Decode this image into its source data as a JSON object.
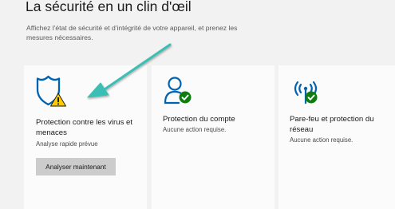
{
  "page": {
    "title": "La sécurité en un clin d'œil",
    "subtitle": "Affichez l'état de sécurité et d'intégrité de votre appareil, et prenez les mesures nécessaires."
  },
  "cards": [
    {
      "title": "Protection contre les virus et menaces",
      "status": "Analyse rapide prévue",
      "button_label": "Analyser maintenant",
      "icon": "shield-warning-icon"
    },
    {
      "title": "Protection du compte",
      "status": "Aucune action requise.",
      "icon": "person-check-icon"
    },
    {
      "title": "Pare-feu et protection du réseau",
      "status": "Aucune action requise.",
      "icon": "wireless-check-icon"
    }
  ],
  "colors": {
    "accent_blue": "#0063b1",
    "warning_yellow": "#ffcc00",
    "success_green": "#107c10",
    "annotation_arrow": "#3bbfb5"
  }
}
